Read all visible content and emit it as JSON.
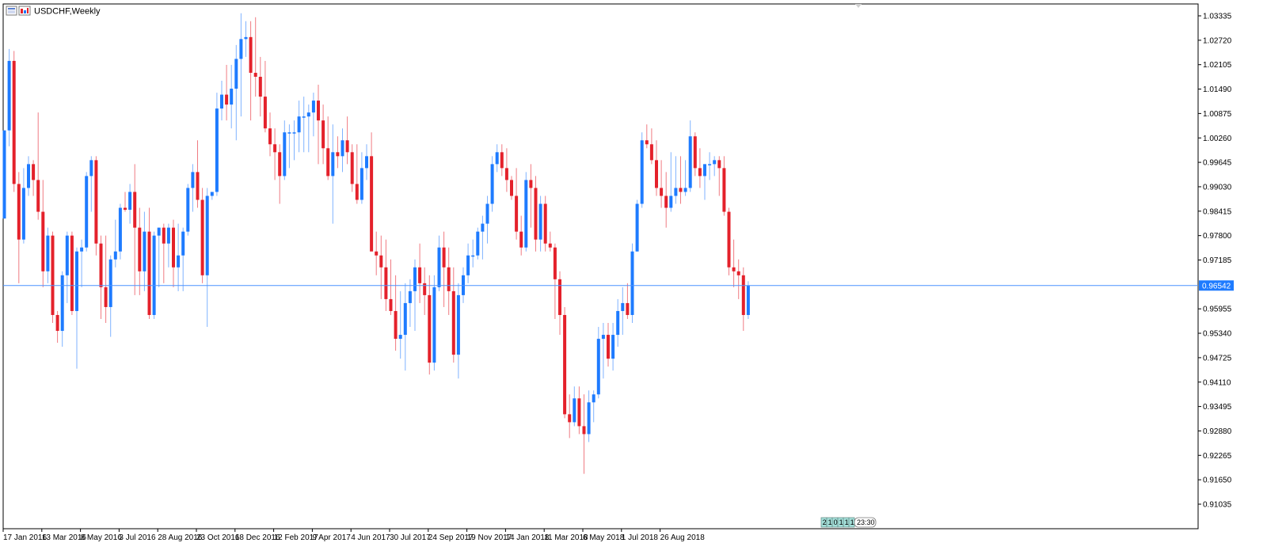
{
  "window": {
    "title": "USDCHF,Weekly"
  },
  "colors": {
    "bull": "#1E7BFF",
    "bear": "#E4212B",
    "bull_wick": "#7FB2FF",
    "bear_wick": "#F07B82",
    "current_line": "#4C93FF",
    "current_label_bg": "#1E7BFF",
    "border": "#000000",
    "background": "#FFFFFF",
    "timer_bg": "#A4E0DA"
  },
  "timer": {
    "cells": [
      "2",
      "1",
      "0",
      "1",
      "1",
      "1"
    ],
    "time": "23:30"
  },
  "chart_data": {
    "type": "candlestick",
    "title": "USDCHF,Weekly",
    "symbol": "USDCHF",
    "timeframe": "Weekly",
    "current_price": 0.96542,
    "current_price_label": "0.96542",
    "ylim": [
      0.9075,
      1.0355
    ],
    "y_ticks": [
      {
        "value": 1.03335,
        "label": "1.03335"
      },
      {
        "value": 1.0272,
        "label": "1.02720"
      },
      {
        "value": 1.02105,
        "label": "1.02105"
      },
      {
        "value": 1.0149,
        "label": "1.01490"
      },
      {
        "value": 1.00875,
        "label": "1.00875"
      },
      {
        "value": 1.0026,
        "label": "1.00260"
      },
      {
        "value": 0.99645,
        "label": "0.99645"
      },
      {
        "value": 0.9903,
        "label": "0.99030"
      },
      {
        "value": 0.98415,
        "label": "0.98415"
      },
      {
        "value": 0.978,
        "label": "0.97800"
      },
      {
        "value": 0.97185,
        "label": "0.97185"
      },
      {
        "value": 0.95955,
        "label": "0.95955"
      },
      {
        "value": 0.9534,
        "label": "0.95340"
      },
      {
        "value": 0.94725,
        "label": "0.94725"
      },
      {
        "value": 0.9411,
        "label": "0.94110"
      },
      {
        "value": 0.93495,
        "label": "0.93495"
      },
      {
        "value": 0.9288,
        "label": "0.92880"
      },
      {
        "value": 0.92265,
        "label": "0.92265"
      },
      {
        "value": 0.9165,
        "label": "0.91650"
      },
      {
        "value": 0.91035,
        "label": "0.91035"
      }
    ],
    "x_ticks": [
      {
        "index": 0,
        "label": "17 Jan 2016"
      },
      {
        "index": 8,
        "label": "13 Mar 2016"
      },
      {
        "index": 16,
        "label": "8 May 2016"
      },
      {
        "index": 24,
        "label": "3 Jul 2016"
      },
      {
        "index": 32,
        "label": "28 Aug 2016"
      },
      {
        "index": 40,
        "label": "23 Oct 2016"
      },
      {
        "index": 48,
        "label": "18 Dec 2016"
      },
      {
        "index": 56,
        "label": "12 Feb 2017"
      },
      {
        "index": 64,
        "label": "9 Apr 2017"
      },
      {
        "index": 72,
        "label": "4 Jun 2017"
      },
      {
        "index": 80,
        "label": "30 Jul 2017"
      },
      {
        "index": 88,
        "label": "24 Sep 2017"
      },
      {
        "index": 96,
        "label": "19 Nov 2017"
      },
      {
        "index": 104,
        "label": "14 Jan 2018"
      },
      {
        "index": 112,
        "label": "11 Mar 2018"
      },
      {
        "index": 120,
        "label": "6 May 2018"
      },
      {
        "index": 128,
        "label": "1 Jul 2018"
      },
      {
        "index": 136,
        "label": "26 Aug 2018"
      }
    ],
    "columns": [
      "open",
      "high",
      "low",
      "close"
    ],
    "candles": [
      [
        0.9823,
        1.0045,
        0.9823,
        1.0045
      ],
      [
        1.0045,
        1.025,
        1.0005,
        1.022
      ],
      [
        1.022,
        1.0245,
        0.989,
        0.991
      ],
      [
        0.991,
        0.994,
        0.966,
        0.977
      ],
      [
        0.977,
        0.995,
        0.976,
        0.99
      ],
      [
        0.99,
        0.998,
        0.988,
        0.996
      ],
      [
        0.996,
        0.997,
        0.988,
        0.992
      ],
      [
        0.992,
        1.009,
        0.982,
        0.984
      ],
      [
        0.984,
        0.992,
        0.965,
        0.969
      ],
      [
        0.969,
        0.98,
        0.966,
        0.978
      ],
      [
        0.978,
        0.979,
        0.956,
        0.958
      ],
      [
        0.958,
        0.959,
        0.951,
        0.954
      ],
      [
        0.954,
        0.969,
        0.95,
        0.968
      ],
      [
        0.968,
        0.979,
        0.961,
        0.978
      ],
      [
        0.978,
        0.979,
        0.958,
        0.959
      ],
      [
        0.959,
        0.975,
        0.9445,
        0.974
      ],
      [
        0.974,
        0.977,
        0.965,
        0.975
      ],
      [
        0.975,
        0.994,
        0.974,
        0.993
      ],
      [
        0.993,
        0.998,
        0.984,
        0.997
      ],
      [
        0.997,
        0.998,
        0.973,
        0.976
      ],
      [
        0.976,
        0.978,
        0.957,
        0.965
      ],
      [
        0.965,
        0.978,
        0.956,
        0.96
      ],
      [
        0.96,
        0.973,
        0.9525,
        0.972
      ],
      [
        0.972,
        0.982,
        0.97,
        0.974
      ],
      [
        0.974,
        0.986,
        0.972,
        0.985
      ],
      [
        0.985,
        0.989,
        0.984,
        0.9845
      ],
      [
        0.9845,
        0.991,
        0.981,
        0.989
      ],
      [
        0.989,
        0.996,
        0.963,
        0.98
      ],
      [
        0.98,
        0.985,
        0.963,
        0.969
      ],
      [
        0.969,
        0.984,
        0.964,
        0.979
      ],
      [
        0.979,
        0.985,
        0.957,
        0.958
      ],
      [
        0.958,
        0.979,
        0.957,
        0.978
      ],
      [
        0.978,
        0.98,
        0.965,
        0.98
      ],
      [
        0.98,
        0.981,
        0.966,
        0.976
      ],
      [
        0.976,
        0.981,
        0.97,
        0.98
      ],
      [
        0.98,
        0.982,
        0.965,
        0.97
      ],
      [
        0.97,
        0.981,
        0.964,
        0.973
      ],
      [
        0.973,
        0.98,
        0.964,
        0.979
      ],
      [
        0.979,
        0.991,
        0.978,
        0.99
      ],
      [
        0.99,
        0.996,
        0.984,
        0.994
      ],
      [
        0.994,
        1.002,
        0.985,
        0.987
      ],
      [
        0.987,
        0.99,
        0.966,
        0.968
      ],
      [
        0.968,
        0.99,
        0.955,
        0.988
      ],
      [
        0.988,
        0.989,
        0.987,
        0.989
      ],
      [
        0.989,
        1.014,
        0.988,
        1.01
      ],
      [
        1.01,
        1.017,
        1.007,
        1.0135
      ],
      [
        1.0135,
        1.021,
        1.007,
        1.011
      ],
      [
        1.011,
        1.021,
        1.005,
        1.015
      ],
      [
        1.015,
        1.026,
        1.002,
        1.0225
      ],
      [
        1.0225,
        1.034,
        1.008,
        1.0275
      ],
      [
        1.0275,
        1.032,
        1.023,
        1.028
      ],
      [
        1.028,
        1.032,
        1.007,
        1.019
      ],
      [
        1.019,
        1.033,
        1.013,
        1.018
      ],
      [
        1.018,
        1.023,
        1.008,
        1.013
      ],
      [
        1.013,
        1.022,
        1.004,
        1.005
      ],
      [
        1.005,
        1.009,
        0.998,
        1.001
      ],
      [
        1.001,
        1.005,
        0.992,
        0.999
      ],
      [
        0.999,
        1.001,
        0.986,
        0.993
      ],
      [
        0.993,
        1.007,
        0.992,
        1.004
      ],
      [
        1.004,
        1.006,
        0.995,
        1.004
      ],
      [
        1.004,
        1.007,
        0.997,
        1.004
      ],
      [
        1.004,
        1.012,
        0.999,
        1.008
      ],
      [
        1.008,
        1.013,
        0.999,
        1.008
      ],
      [
        1.008,
        1.011,
        0.999,
        1.009
      ],
      [
        1.009,
        1.014,
        1.003,
        1.012
      ],
      [
        1.012,
        1.016,
        0.996,
        1.007
      ],
      [
        1.007,
        1.011,
        0.996,
        1.0
      ],
      [
        1.0,
        1.008,
        0.992,
        0.993
      ],
      [
        0.993,
        1.006,
        0.981,
        0.999
      ],
      [
        0.999,
        1.003,
        0.995,
        0.998
      ],
      [
        0.998,
        1.005,
        0.994,
        1.002
      ],
      [
        1.002,
        1.008,
        0.996,
        0.999
      ],
      [
        0.999,
        1.001,
        0.989,
        0.991
      ],
      [
        0.991,
        1.001,
        0.986,
        0.987
      ],
      [
        0.987,
        0.999,
        0.986,
        0.995
      ],
      [
        0.995,
        1.001,
        0.992,
        0.998
      ],
      [
        0.998,
        1.004,
        0.976,
        0.974
      ],
      [
        0.974,
        0.979,
        0.968,
        0.973
      ],
      [
        0.973,
        0.978,
        0.962,
        0.97
      ],
      [
        0.97,
        0.977,
        0.959,
        0.962
      ],
      [
        0.962,
        0.972,
        0.958,
        0.959
      ],
      [
        0.959,
        0.968,
        0.949,
        0.952
      ],
      [
        0.952,
        0.964,
        0.947,
        0.953
      ],
      [
        0.953,
        0.966,
        0.944,
        0.961
      ],
      [
        0.961,
        0.967,
        0.955,
        0.964
      ],
      [
        0.964,
        0.972,
        0.954,
        0.97
      ],
      [
        0.97,
        0.976,
        0.961,
        0.966
      ],
      [
        0.966,
        0.97,
        0.958,
        0.963
      ],
      [
        0.963,
        0.968,
        0.943,
        0.946
      ],
      [
        0.946,
        0.968,
        0.944,
        0.965
      ],
      [
        0.965,
        0.978,
        0.964,
        0.975
      ],
      [
        0.975,
        0.979,
        0.96,
        0.97
      ],
      [
        0.97,
        0.975,
        0.958,
        0.964
      ],
      [
        0.964,
        0.97,
        0.946,
        0.948
      ],
      [
        0.948,
        0.966,
        0.942,
        0.963
      ],
      [
        0.963,
        0.97,
        0.961,
        0.968
      ],
      [
        0.968,
        0.976,
        0.966,
        0.973
      ],
      [
        0.973,
        0.977,
        0.97,
        0.973
      ],
      [
        0.973,
        0.98,
        0.972,
        0.979
      ],
      [
        0.979,
        0.983,
        0.972,
        0.981
      ],
      [
        0.981,
        0.988,
        0.976,
        0.986
      ],
      [
        0.986,
        0.998,
        0.984,
        0.996
      ],
      [
        0.996,
        1.001,
        0.994,
        0.999
      ],
      [
        0.999,
        1.001,
        0.993,
        0.995
      ],
      [
        0.995,
        1.0,
        0.989,
        0.992
      ],
      [
        0.992,
        0.993,
        0.987,
        0.988
      ],
      [
        0.988,
        0.995,
        0.977,
        0.979
      ],
      [
        0.979,
        0.983,
        0.973,
        0.975
      ],
      [
        0.975,
        0.994,
        0.974,
        0.992
      ],
      [
        0.992,
        0.996,
        0.98,
        0.99
      ],
      [
        0.99,
        0.993,
        0.974,
        0.977
      ],
      [
        0.977,
        0.988,
        0.974,
        0.986
      ],
      [
        0.986,
        0.988,
        0.974,
        0.976
      ],
      [
        0.976,
        0.979,
        0.974,
        0.975
      ],
      [
        0.975,
        0.976,
        0.957,
        0.967
      ],
      [
        0.967,
        0.969,
        0.953,
        0.958
      ],
      [
        0.958,
        0.96,
        0.932,
        0.933
      ],
      [
        0.933,
        0.938,
        0.927,
        0.931
      ],
      [
        0.931,
        0.94,
        0.93,
        0.937
      ],
      [
        0.937,
        0.94,
        0.928,
        0.93
      ],
      [
        0.93,
        0.938,
        0.918,
        0.928
      ],
      [
        0.928,
        0.939,
        0.926,
        0.936
      ],
      [
        0.936,
        0.939,
        0.931,
        0.938
      ],
      [
        0.938,
        0.955,
        0.937,
        0.952
      ],
      [
        0.952,
        0.956,
        0.942,
        0.953
      ],
      [
        0.953,
        0.956,
        0.945,
        0.947
      ],
      [
        0.947,
        0.956,
        0.944,
        0.953
      ],
      [
        0.953,
        0.962,
        0.95,
        0.959
      ],
      [
        0.959,
        0.965,
        0.953,
        0.961
      ],
      [
        0.961,
        0.966,
        0.957,
        0.958
      ],
      [
        0.958,
        0.976,
        0.956,
        0.974
      ],
      [
        0.974,
        0.987,
        0.974,
        0.986
      ],
      [
        0.986,
        1.004,
        0.985,
        1.002
      ],
      [
        1.002,
        1.006,
        1.0,
        1.001
      ],
      [
        1.001,
        1.005,
        0.996,
        0.997
      ],
      [
        0.997,
        1.002,
        0.988,
        0.99
      ],
      [
        0.99,
        0.997,
        0.985,
        0.988
      ],
      [
        0.988,
        0.994,
        0.98,
        0.985
      ],
      [
        0.985,
        0.999,
        0.984,
        0.988
      ],
      [
        0.988,
        0.998,
        0.986,
        0.99
      ],
      [
        0.99,
        0.998,
        0.986,
        0.989
      ],
      [
        0.989,
        0.997,
        0.988,
        0.99
      ],
      [
        0.99,
        1.007,
        0.989,
        1.003
      ],
      [
        1.003,
        1.004,
        0.993,
        0.995
      ],
      [
        0.995,
        1.0,
        0.99,
        0.993
      ],
      [
        0.993,
        0.996,
        0.987,
        0.996
      ],
      [
        0.996,
        0.999,
        0.992,
        0.996
      ],
      [
        0.996,
        0.998,
        0.993,
        0.997
      ],
      [
        0.997,
        0.998,
        0.988,
        0.995
      ],
      [
        0.995,
        0.998,
        0.983,
        0.984
      ],
      [
        0.984,
        0.985,
        0.968,
        0.97
      ],
      [
        0.97,
        0.977,
        0.965,
        0.969
      ],
      [
        0.969,
        0.972,
        0.962,
        0.968
      ],
      [
        0.968,
        0.97,
        0.954,
        0.958
      ],
      [
        0.958,
        0.9665,
        0.957,
        0.9654
      ]
    ]
  }
}
